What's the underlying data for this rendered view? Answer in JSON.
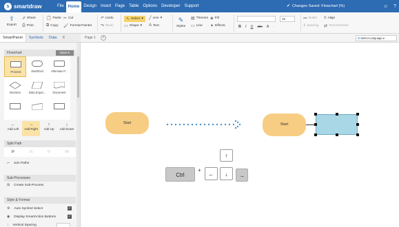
{
  "app": {
    "name": "smartdraw",
    "saved_status": "Changes Saved: Flowchart (%)",
    "accent": "#2d6bb3"
  },
  "menu": [
    "File",
    "Home",
    "Design",
    "Insert",
    "Page",
    "Table",
    "Options",
    "Developer",
    "Support"
  ],
  "ribbon": {
    "export": "Export",
    "share": "Share",
    "print": "Print",
    "paste": "Paste",
    "copy": "Copy",
    "cut": "Cut",
    "format_painter": "Format Painter",
    "undo": "Undo",
    "redo": "Redo",
    "select": "Select",
    "line": "Line",
    "shape": "Shape",
    "text": "Text",
    "styles": "Styles",
    "themes": "Themes",
    "fill": "Fill",
    "line2": "Line",
    "effects": "Effects",
    "font_size": "10",
    "bullet": "Bullet",
    "align": "Align",
    "spacing": "Spacing",
    "text_direction": "Text Direction",
    "format_buttons": [
      "B",
      "I",
      "U",
      "abc",
      "A",
      "·"
    ]
  },
  "left_tabs": [
    "SmartPanel",
    "Symbols",
    "Data"
  ],
  "left_tab_close": "X",
  "page_tab": "Page 1",
  "add_page": "+",
  "language": "Select Language",
  "panel": {
    "flowchart_header": "Flowchart",
    "more": "More",
    "shapes": [
      {
        "label": "Process"
      },
      {
        "label": "Start/End"
      },
      {
        "label": "Alternate P..."
      },
      {
        "label": "Decision"
      },
      {
        "label": "Data (Input..."
      },
      {
        "label": "Document"
      },
      {
        "label": ""
      },
      {
        "label": ""
      },
      {
        "label": ""
      }
    ],
    "add_buttons": [
      {
        "label": "Add Left",
        "icon": "←"
      },
      {
        "label": "Add Right",
        "icon": "→"
      },
      {
        "label": "Add Up",
        "icon": "↑"
      },
      {
        "label": "Add Down",
        "icon": "↓"
      }
    ],
    "split_header": "Split Path",
    "split_icons": [
      "⊮",
      "∴",
      "∵",
      "∷"
    ],
    "join_paths": "Join Paths",
    "subprocess_header": "Sub-Processes",
    "create_subprocess": "Create Sub-Process",
    "style_header": "Style & Format",
    "auto_symbol_select": "Auto Symbol Select",
    "display_smartaction": "Display SmartAction Buttons",
    "vertical_spacing": "Vertical Spacing"
  },
  "canvas": {
    "start1": "Start",
    "start2": "Start",
    "key_ctrl": "Ctrl",
    "key_plus": "+",
    "key_up": "↑",
    "key_left": "←",
    "key_down": "↓",
    "key_right": "→"
  }
}
